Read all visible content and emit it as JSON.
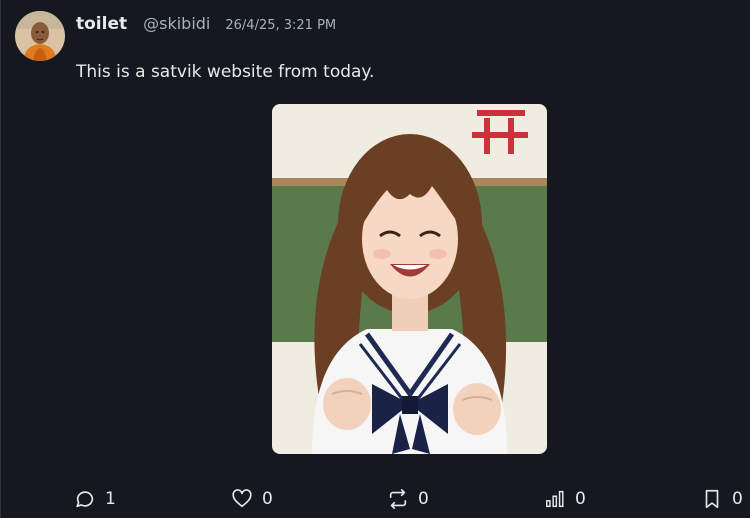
{
  "post": {
    "author": {
      "display_name": "toilet",
      "handle": "@skibidi"
    },
    "timestamp": "26/4/25, 3:21 PM",
    "text": "This is a satvik website from today.",
    "media": {
      "kind": "animated-image",
      "description_icon": "photo"
    }
  },
  "actions": {
    "reply": {
      "icon": "comment-icon",
      "count": "1"
    },
    "like": {
      "icon": "heart-icon",
      "count": "0"
    },
    "repost": {
      "icon": "repost-icon",
      "count": "0"
    },
    "views": {
      "icon": "bar-chart-icon",
      "count": "0"
    },
    "bookmark": {
      "icon": "bookmark-icon",
      "count": "0"
    }
  },
  "colors": {
    "background": "#15191f",
    "text_primary": "#e7e9ea",
    "text_secondary": "#a9b0b6"
  }
}
